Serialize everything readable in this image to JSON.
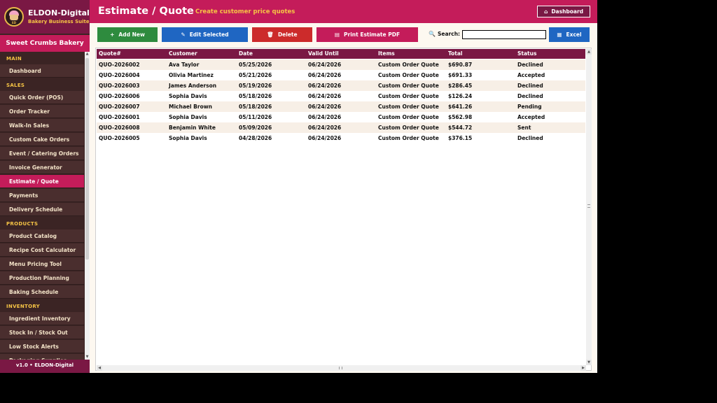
{
  "brand": {
    "name": "ELDON-Digital",
    "subtitle": "Bakery Business Suite",
    "logo_text": "ED"
  },
  "shop_name": "Sweet Crumbs Bakery",
  "sidebar": {
    "sections": [
      {
        "title": "MAIN",
        "items": [
          {
            "label": "Dashboard"
          }
        ]
      },
      {
        "title": "SALES",
        "items": [
          {
            "label": "Quick Order (POS)"
          },
          {
            "label": "Order Tracker"
          },
          {
            "label": "Walk-In Sales"
          },
          {
            "label": "Custom Cake Orders"
          },
          {
            "label": "Event / Catering Orders"
          },
          {
            "label": "Invoice Generator"
          },
          {
            "label": "Estimate / Quote",
            "active": true
          },
          {
            "label": "Payments"
          },
          {
            "label": "Delivery Schedule"
          }
        ]
      },
      {
        "title": "PRODUCTS",
        "items": [
          {
            "label": "Product Catalog"
          },
          {
            "label": "Recipe Cost Calculator"
          },
          {
            "label": "Menu Pricing Tool"
          },
          {
            "label": "Production Planning"
          },
          {
            "label": "Baking Schedule"
          }
        ]
      },
      {
        "title": "INVENTORY",
        "items": [
          {
            "label": "Ingredient Inventory"
          },
          {
            "label": "Stock In / Stock Out"
          },
          {
            "label": "Low Stock Alerts"
          },
          {
            "label": "Packaging Supplies"
          }
        ]
      }
    ]
  },
  "version": "v1.0  •  ELDON-Digital",
  "header": {
    "title": "Estimate / Quote",
    "subtitle": "Create customer price quotes",
    "dashboard_button": "Dashboard"
  },
  "toolbar": {
    "add": "Add New",
    "edit": "Edit Selected",
    "delete": "Delete",
    "print": "Print Estimate PDF",
    "search_label": "Search:",
    "search_value": "",
    "excel": "Excel"
  },
  "table": {
    "columns": [
      "Quote#",
      "Customer",
      "Date",
      "Valid Until",
      "Items",
      "Total",
      "Status"
    ],
    "rows": [
      [
        "QUO-2026002",
        "Ava Taylor",
        "05/25/2026",
        "06/24/2026",
        "Custom Order Quote",
        "$690.87",
        "Declined"
      ],
      [
        "QUO-2026004",
        "Olivia Martinez",
        "05/21/2026",
        "06/24/2026",
        "Custom Order Quote",
        "$691.33",
        "Accepted"
      ],
      [
        "QUO-2026003",
        "James Anderson",
        "05/19/2026",
        "06/24/2026",
        "Custom Order Quote",
        "$286.45",
        "Declined"
      ],
      [
        "QUO-2026006",
        "Sophia Davis",
        "05/18/2026",
        "06/24/2026",
        "Custom Order Quote",
        "$126.24",
        "Declined"
      ],
      [
        "QUO-2026007",
        "Michael Brown",
        "05/18/2026",
        "06/24/2026",
        "Custom Order Quote",
        "$641.26",
        "Pending"
      ],
      [
        "QUO-2026001",
        "Sophia Davis",
        "05/11/2026",
        "06/24/2026",
        "Custom Order Quote",
        "$562.98",
        "Accepted"
      ],
      [
        "QUO-2026008",
        "Benjamin White",
        "05/09/2026",
        "06/24/2026",
        "Custom Order Quote",
        "$544.72",
        "Sent"
      ],
      [
        "QUO-2026005",
        "Sophia Davis",
        "04/28/2026",
        "06/24/2026",
        "Custom Order Quote",
        "$376.15",
        "Declined"
      ]
    ]
  },
  "colors": {
    "primary": "#c41c5a",
    "dark_primary": "#7a1844",
    "sidebar_bg": "#3b2424",
    "accent_gold": "#f6c445",
    "add_green": "#2e8b3e",
    "action_blue": "#1f66c2",
    "delete_red": "#cc2b2b"
  },
  "icons": {
    "add": "plus-icon",
    "edit": "pencil-icon",
    "delete": "trash-icon",
    "print": "printer-icon",
    "search": "search-icon",
    "excel": "excel-icon",
    "dashboard": "home-icon"
  }
}
